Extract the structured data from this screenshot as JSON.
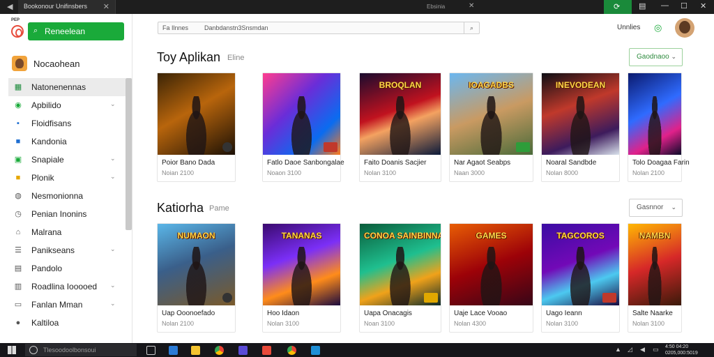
{
  "window": {
    "tab_title": "Bookonour Unifinsbers",
    "toolbar_text": "Ebsinia"
  },
  "sidebar": {
    "logo_text": "PEP",
    "search_button_label": "Reneelean",
    "profile_name": "Nocaohean",
    "items": [
      {
        "label": "Natonenennas",
        "icon": "app-grid-icon",
        "icon_glyph": "▦",
        "icon_color": "#1a8a3a",
        "has_chevron": false,
        "active": true
      },
      {
        "label": "Apbilido",
        "icon": "globe-icon",
        "icon_glyph": "◉",
        "icon_color": "#1aaa3a",
        "has_chevron": true,
        "active": false
      },
      {
        "label": "Floidfisans",
        "icon": "folder-icon",
        "icon_glyph": "▪",
        "icon_color": "#1f6fd1",
        "has_chevron": false,
        "active": false
      },
      {
        "label": "Kandonia",
        "icon": "store-icon",
        "icon_glyph": "■",
        "icon_color": "#1f6fd1",
        "has_chevron": false,
        "active": false
      },
      {
        "label": "Snapiale",
        "icon": "calendar-icon",
        "icon_glyph": "▣",
        "icon_color": "#1aaa3a",
        "has_chevron": true,
        "active": false
      },
      {
        "label": "Plonik",
        "icon": "bookmark-icon",
        "icon_glyph": "■",
        "icon_color": "#e6a700",
        "has_chevron": true,
        "active": false
      },
      {
        "label": "Nesmonionna",
        "icon": "user-icon",
        "icon_glyph": "◍",
        "icon_color": "#555555",
        "has_chevron": false,
        "active": false
      },
      {
        "label": "Penian Inonins",
        "icon": "clock-icon",
        "icon_glyph": "◷",
        "icon_color": "#555555",
        "has_chevron": false,
        "active": false
      },
      {
        "label": "Malrana",
        "icon": "home-icon",
        "icon_glyph": "⌂",
        "icon_color": "#555555",
        "has_chevron": false,
        "active": false
      },
      {
        "label": "Panikseans",
        "icon": "list-icon",
        "icon_glyph": "☰",
        "icon_color": "#555555",
        "has_chevron": true,
        "active": false
      },
      {
        "label": "Pandolo",
        "icon": "document-icon",
        "icon_glyph": "▤",
        "icon_color": "#555555",
        "has_chevron": false,
        "active": false
      },
      {
        "label": "Roadlina Iooooed",
        "icon": "chart-icon",
        "icon_glyph": "▥",
        "icon_color": "#555555",
        "has_chevron": true,
        "active": false
      },
      {
        "label": "Fanlan Mman",
        "icon": "folder-outline-icon",
        "icon_glyph": "▭",
        "icon_color": "#555555",
        "has_chevron": true,
        "active": false
      },
      {
        "label": "Kaltiloa",
        "icon": "person-icon",
        "icon_glyph": "●",
        "icon_color": "#555555",
        "has_chevron": false,
        "active": false
      }
    ]
  },
  "header": {
    "address_prefix": "Fa Ilnnes",
    "address_text": "Danbdanstn3Snsmdan",
    "top_link": "Unnlies"
  },
  "sections": [
    {
      "title": "Toy Aplikan",
      "subtitle": "Eline",
      "button_label": "Gaodnaoo",
      "cards": [
        {
          "name": "Poior Bano Dada",
          "meta": "Noian 2100",
          "logo": "",
          "badge": "shield-badge-icon",
          "art": "img1"
        },
        {
          "name": "Fatlo Daoe Sanbongalae",
          "meta": "Noaon 3100",
          "logo": "",
          "badge": "red-badge-icon",
          "art": "img2"
        },
        {
          "name": "Faito Doanis Sacjier",
          "meta": "Nolan 3100",
          "logo": "BROQLAN",
          "badge": "",
          "art": "img3"
        },
        {
          "name": "Nar Agaot Seabps",
          "meta": "Naan 3000",
          "logo": "IOAGADBS",
          "badge": "green-badge-icon",
          "art": "img4"
        },
        {
          "name": "Noaral Sandbde",
          "meta": "Nolan 8000",
          "logo": "INEVODEAN",
          "badge": "",
          "art": "img5"
        },
        {
          "name": "Tolo Doagaa Farin",
          "meta": "Nolan 2100",
          "logo": "",
          "badge": "",
          "art": "img6"
        }
      ]
    },
    {
      "title": "Katiorha",
      "subtitle": "Pame",
      "button_label": "Gasnnor",
      "cards": [
        {
          "name": "Uap Ooonoefado",
          "meta": "Nolan 2100",
          "logo": "NUMAON",
          "badge": "shield-badge-icon",
          "art": "img7"
        },
        {
          "name": "Hoo Idaon",
          "meta": "Nolan 3100",
          "logo": "TANANAS",
          "badge": "",
          "art": "img8"
        },
        {
          "name": "Uapa Onacagis",
          "meta": "Noan 3100",
          "logo": "CONOA SAINBINNA",
          "badge": "gold-badge-icon",
          "art": "img9"
        },
        {
          "name": "Uaje Lace Vooao",
          "meta": "Nolan 4300",
          "logo": "GAMES",
          "badge": "",
          "art": "img10"
        },
        {
          "name": "Uago Ieann",
          "meta": "Nolan 3100",
          "logo": "TAGCOROS",
          "badge": "red-badge-icon",
          "art": "img11"
        },
        {
          "name": "Salte Naarke",
          "meta": "Nolan 3100",
          "logo": "NAMBN",
          "badge": "",
          "art": "img12"
        }
      ]
    }
  ],
  "taskbar": {
    "search_text": "Tlesoodoolbonsoui",
    "clock_line1": "4:50 04:20",
    "clock_line2": "0205,000:5019"
  },
  "colors": {
    "accent_green": "#1aaa3a",
    "sidebar_active": "#ebebeb",
    "titlebar": "#1e1e1e",
    "taskbar": "#16161a"
  }
}
